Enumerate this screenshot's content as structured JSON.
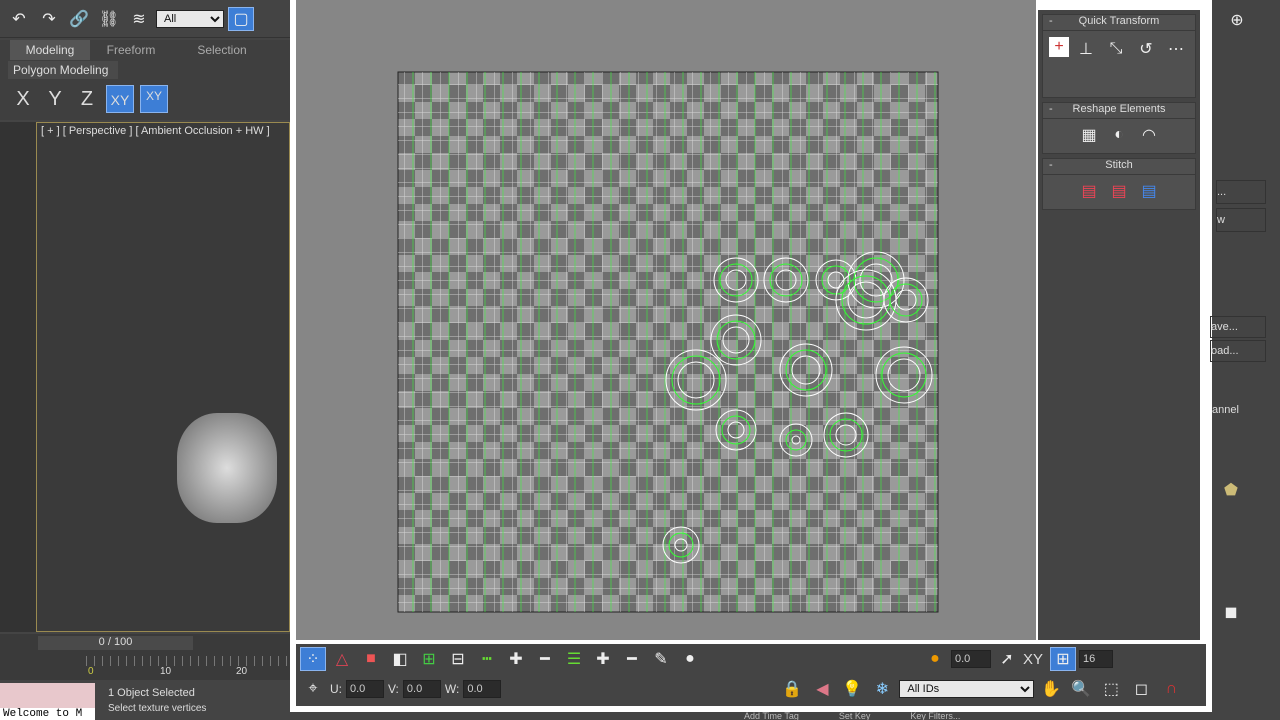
{
  "main_toolbar": {
    "selection_filter": "All"
  },
  "ribbon": {
    "tabs": [
      {
        "label": "Modeling"
      },
      {
        "label": "Freeform"
      },
      {
        "label": "Selection"
      }
    ],
    "panel": "Polygon Modeling",
    "axes": [
      "X",
      "Y",
      "Z",
      "XY",
      "XY"
    ]
  },
  "viewport": {
    "label": "[ + ] [ Perspective ] [ Ambient Occlusion + HW ]"
  },
  "timeline": {
    "frame": "0 / 100",
    "ticks": [
      "0",
      "10",
      "20"
    ]
  },
  "status": {
    "selected": "1 Object Selected",
    "prompt": "Select texture vertices",
    "script": "Welcome to M"
  },
  "uv_editor": {
    "quick_transform": "Quick Transform",
    "reshape": "Reshape Elements",
    "stitch": "Stitch",
    "bottom": {
      "u_label": "U:",
      "u": "0.0",
      "v_label": "V:",
      "v": "0.0",
      "w_label": "W:",
      "w": "0.0",
      "soft_value": "0.0",
      "xy": "XY",
      "grid_value": "16",
      "id_filter": "All IDs"
    }
  },
  "right_panel": {
    "items": [
      "...",
      "w",
      "ave...",
      "oad...",
      "annel"
    ]
  },
  "trackbar": {
    "add_time_tag": "Add Time Tag",
    "set_key": "Set Key",
    "key_filters": "Key Filters..."
  },
  "colors": {
    "accent": "#3d7ed6",
    "uv_green": "#33ff33"
  }
}
